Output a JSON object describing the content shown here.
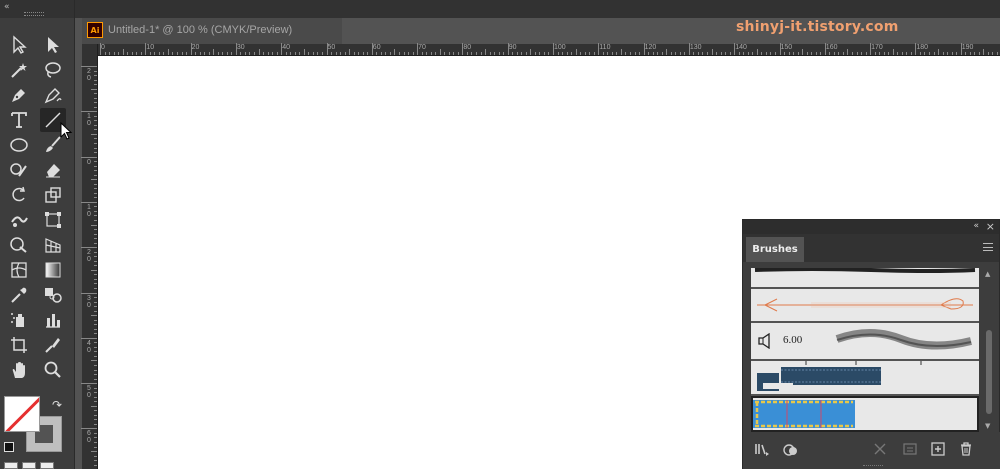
{
  "document": {
    "title": "Untitled-1* @ 100 % (CMYK/Preview)",
    "app_badge": "Ai"
  },
  "watermark": "shinyj-it.tistory.com",
  "ruler": {
    "horizontal": [
      "0",
      "10",
      "20",
      "30",
      "40",
      "50",
      "60",
      "70",
      "80",
      "90",
      "100",
      "110",
      "120",
      "130",
      "140",
      "150",
      "160",
      "170",
      "180",
      "190"
    ],
    "vertical": [
      "20",
      "10",
      "0",
      "10",
      "20",
      "30",
      "40",
      "50",
      "60",
      "70",
      "80",
      "90",
      "100",
      "110",
      "120",
      "130"
    ]
  },
  "tools": [
    {
      "name": "selection-tool",
      "icon": "arrow-outline-icon"
    },
    {
      "name": "direct-selection-tool",
      "icon": "arrow-filled-icon"
    },
    {
      "name": "magic-wand-tool",
      "icon": "magic-wand-icon"
    },
    {
      "name": "lasso-tool",
      "icon": "lasso-icon"
    },
    {
      "name": "pen-tool",
      "icon": "pen-icon"
    },
    {
      "name": "curvature-tool",
      "icon": "curvature-icon"
    },
    {
      "name": "type-tool",
      "icon": "type-icon"
    },
    {
      "name": "line-segment-tool",
      "icon": "line-icon"
    },
    {
      "name": "ellipse-tool",
      "icon": "ellipse-icon"
    },
    {
      "name": "paintbrush-tool",
      "icon": "brush-icon"
    },
    {
      "name": "shaper-tool",
      "icon": "shaper-icon"
    },
    {
      "name": "eraser-tool",
      "icon": "eraser-icon"
    },
    {
      "name": "rotate-tool",
      "icon": "rotate-icon"
    },
    {
      "name": "scale-tool",
      "icon": "scale-icon"
    },
    {
      "name": "warp-tool",
      "icon": "warp-icon"
    },
    {
      "name": "free-transform-tool",
      "icon": "free-transform-icon"
    },
    {
      "name": "shape-builder-tool",
      "icon": "shape-builder-icon"
    },
    {
      "name": "perspective-grid-tool",
      "icon": "perspective-icon"
    },
    {
      "name": "mesh-tool",
      "icon": "mesh-icon"
    },
    {
      "name": "gradient-tool",
      "icon": "gradient-icon"
    },
    {
      "name": "eyedropper-tool",
      "icon": "eyedropper-icon"
    },
    {
      "name": "blend-tool",
      "icon": "blend-icon"
    },
    {
      "name": "symbol-sprayer-tool",
      "icon": "symbol-sprayer-icon"
    },
    {
      "name": "column-graph-tool",
      "icon": "graph-icon"
    },
    {
      "name": "artboard-tool",
      "icon": "artboard-icon"
    },
    {
      "name": "slice-tool",
      "icon": "slice-icon"
    },
    {
      "name": "hand-tool",
      "icon": "hand-icon"
    },
    {
      "name": "zoom-tool",
      "icon": "zoom-icon"
    }
  ],
  "brushes_panel": {
    "tab_label": "Brushes",
    "brush_size_label": "6.00"
  },
  "colors": {
    "accent_orange": "#ff9a00",
    "watermark": "#f0a070",
    "none_red": "#e53030",
    "selection_blue": "#3a8fd6"
  }
}
